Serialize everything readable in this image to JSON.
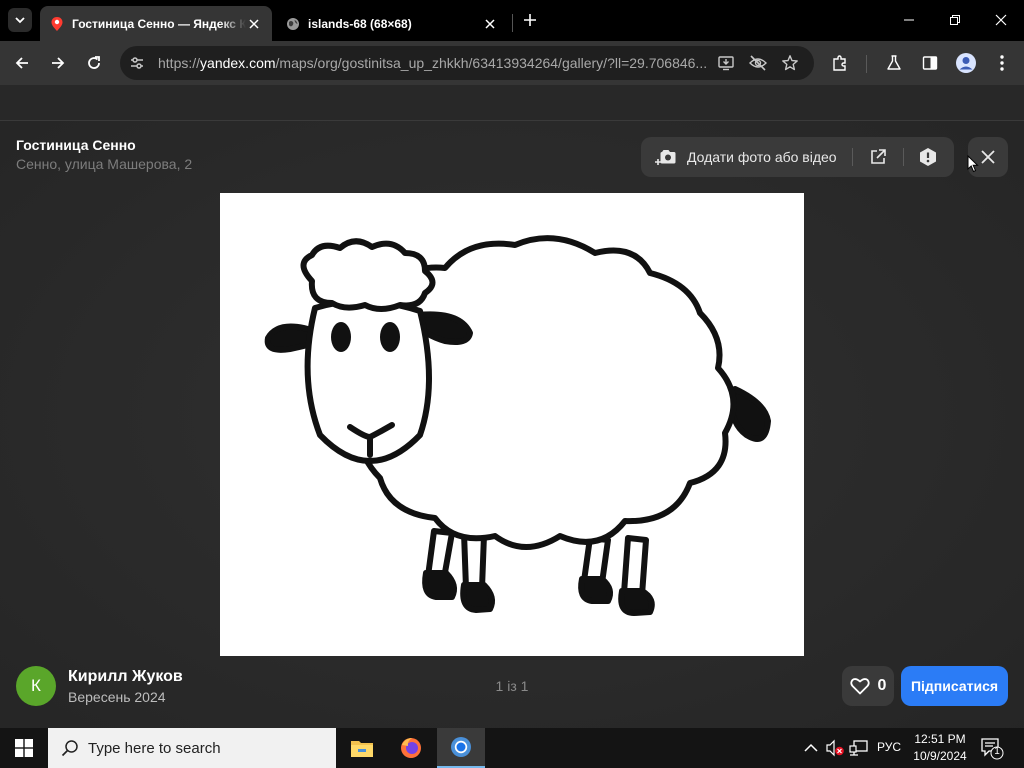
{
  "browser": {
    "tabs": [
      {
        "title": "Гостиница Сенно — Яндекс Карты",
        "active": true
      },
      {
        "title": "islands-68 (68×68)",
        "active": false
      }
    ],
    "url_scheme": "https://",
    "url_host": "yandex.com",
    "url_path": "/maps/org/gostinitsa_up_zhkkh/63413934264/gallery/?ll=29.706846..."
  },
  "viewer": {
    "place_name": "Гостиница Сенно",
    "place_address": "Сенно, улица Машерова, 2",
    "add_media_label": "Додати фото або відео",
    "photo_counter": "1 із 1",
    "author_initial": "К",
    "author_name": "Кирилл Жуков",
    "author_date": "Вересень 2024",
    "likes": "0",
    "subscribe_label": "Підписатися"
  },
  "taskbar": {
    "search_placeholder": "Type here to search",
    "language": "РУС",
    "time": "12:51 PM",
    "date": "10/9/2024",
    "notification_count": "1"
  },
  "colors": {
    "accent_blue": "#2b7cf6",
    "avatar_green": "#5aa62a",
    "maps_pin_red": "#ff3b30"
  }
}
